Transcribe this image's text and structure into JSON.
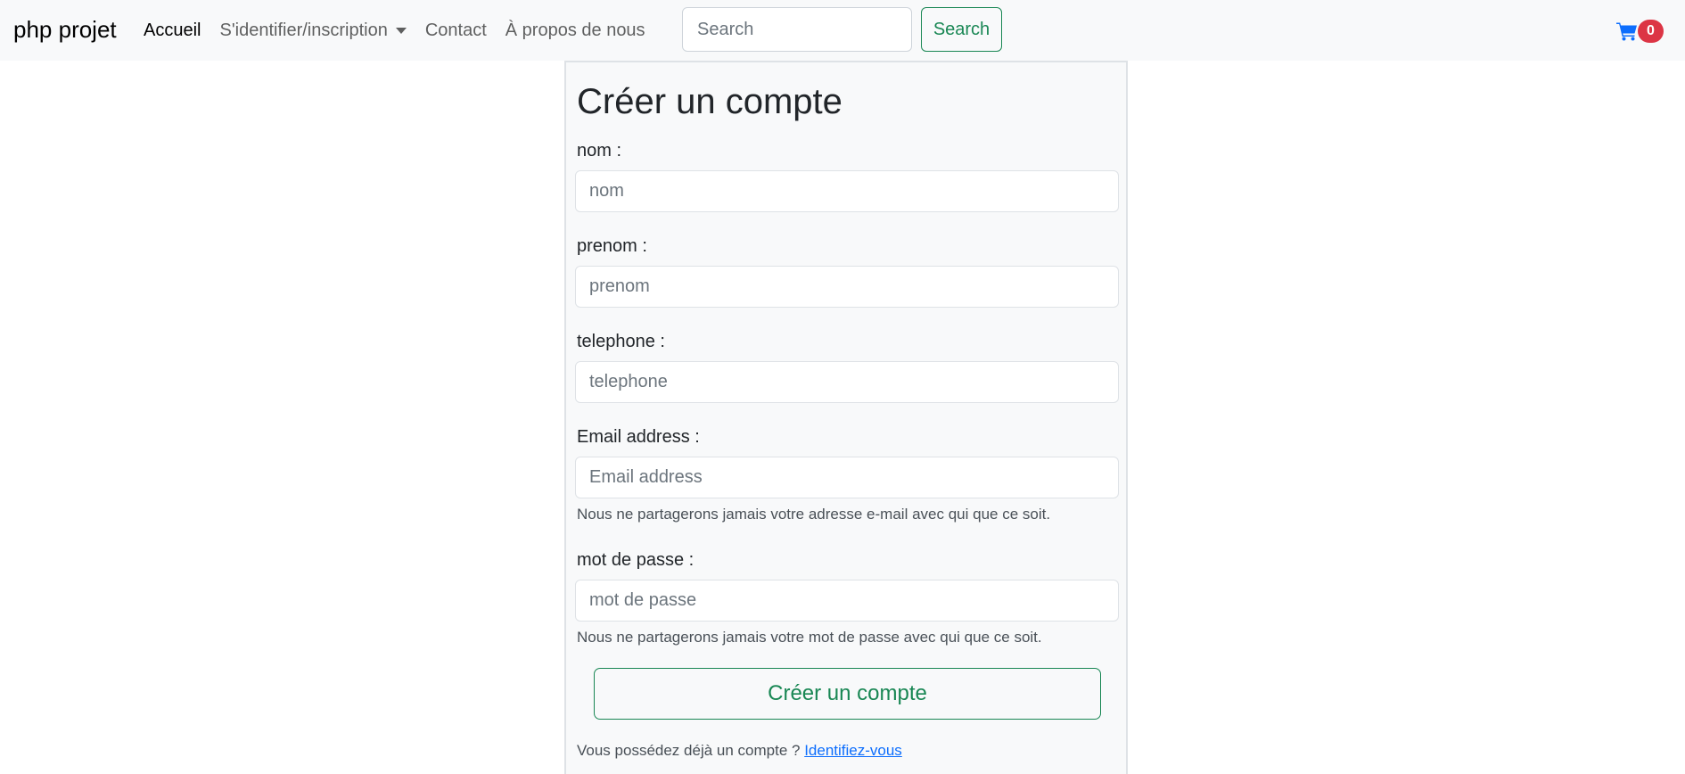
{
  "navbar": {
    "brand": "php projet",
    "links": [
      {
        "label": "Accueil"
      },
      {
        "label": "S'identifier/inscription"
      },
      {
        "label": "Contact"
      },
      {
        "label": "À propos de nous"
      }
    ],
    "search": {
      "placeholder": "Search",
      "button_label": "Search"
    },
    "cart": {
      "icon": "cart-icon",
      "count": "0",
      "badge_color": "#dc3545"
    }
  },
  "form": {
    "title": "Créer un compte",
    "fields": [
      {
        "label": "nom :",
        "placeholder": "nom"
      },
      {
        "label": "prenom :",
        "placeholder": "prenom"
      },
      {
        "label": "telephone :",
        "placeholder": "telephone"
      },
      {
        "label": "Email address :",
        "placeholder": "Email address",
        "help": "Nous ne partagerons jamais votre adresse e-mail avec qui que ce soit."
      },
      {
        "label": "mot de passe :",
        "placeholder": "mot de passe",
        "help": "Nous ne partagerons jamais votre mot de passe avec qui que ce soit."
      }
    ],
    "submit_label": "Créer un compte",
    "login_prompt": "Vous possédez déjà un compte ?",
    "login_link": "Identifiez-vous"
  },
  "colors": {
    "success": "#198754",
    "danger": "#dc3545",
    "link": "#0d6efd",
    "navbar_bg": "#f8f9fa"
  }
}
